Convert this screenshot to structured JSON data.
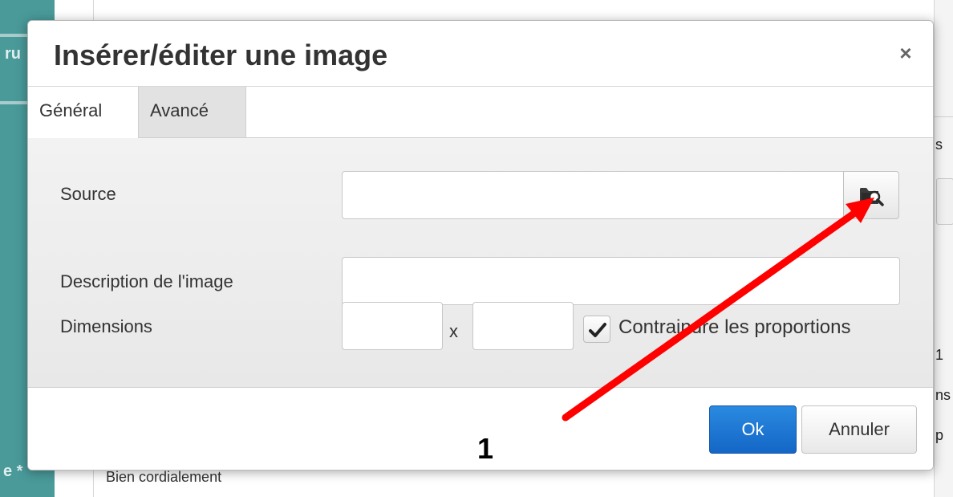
{
  "background": {
    "sidebar_frag_top": "ru",
    "sidebar_frag_bottom": "e *",
    "right_frag_1": "s",
    "right_frag_2": "1",
    "right_frag_3": "ns",
    "right_frag_4": "p",
    "bottom_text": "Bien cordialement"
  },
  "dialog": {
    "title": "Insérer/éditer une image",
    "close_symbol": "×",
    "tabs": [
      {
        "label": "Général"
      },
      {
        "label": "Avancé"
      }
    ],
    "fields": {
      "source_label": "Source",
      "source_value": "",
      "description_label": "Description de l'image",
      "description_value": "",
      "dimensions_label": "Dimensions",
      "width_value": "",
      "height_value": "",
      "dimension_separator": "x",
      "constrain_label": "Contraindre les proportions",
      "constrain_checked": true
    },
    "buttons": {
      "ok_label": "Ok",
      "cancel_label": "Annuler"
    }
  },
  "annotation": {
    "step_number": "1",
    "arrow_color": "#ff0000"
  },
  "colors": {
    "primary_button": "#1a73d4",
    "sidebar": "#4a9a9a"
  },
  "icons": {
    "browse": "folder-search-icon",
    "checkbox": "checkmark-icon",
    "close": "close-icon"
  }
}
